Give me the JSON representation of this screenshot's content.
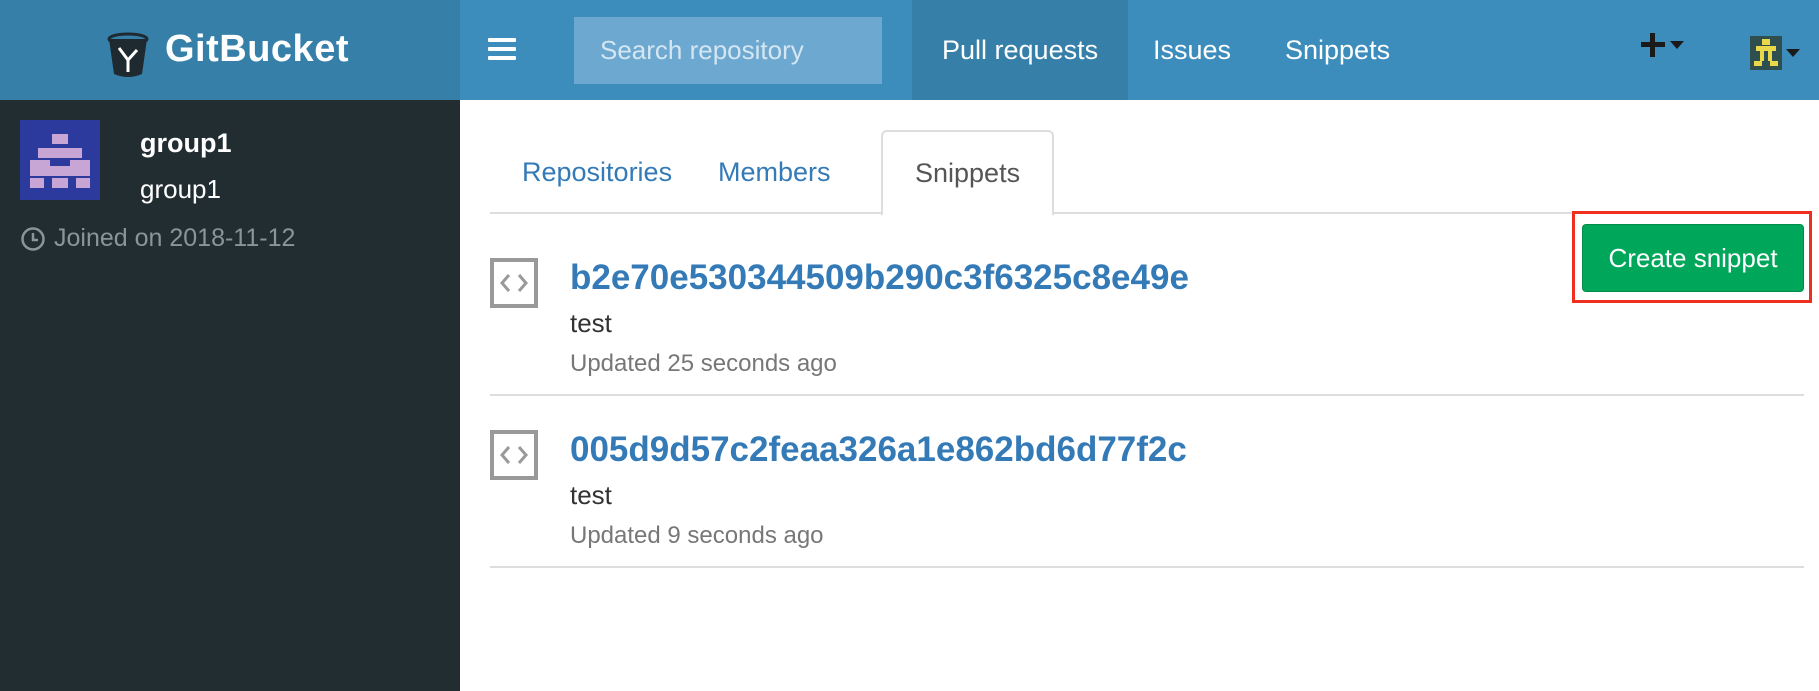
{
  "header": {
    "brand": "GitBucket",
    "search_placeholder": "Search repository",
    "nav": [
      "Pull requests",
      "Issues",
      "Snippets"
    ],
    "active_nav": "Pull requests",
    "plus_icon": "plus-icon",
    "user_icon": "user-avatar-icon"
  },
  "sidebar": {
    "group_name": "group1",
    "group_display": "group1",
    "joined": "Joined on 2018-11-12"
  },
  "tabs": [
    "Repositories",
    "Members",
    "Snippets"
  ],
  "active_tab": "Snippets",
  "create_button": "Create snippet",
  "snippets": [
    {
      "title": "b2e70e530344509b290c3f6325c8e49e",
      "description": "test",
      "updated": "Updated 25 seconds ago"
    },
    {
      "title": "005d9d57c2feaa326a1e862bd6d77f2c",
      "description": "test",
      "updated": "Updated 9 seconds ago"
    }
  ],
  "colors": {
    "header": "#3c8dbc",
    "brand_bg": "#367fa9",
    "sidebar": "#222d32",
    "link": "#337ab7",
    "success": "#00a65a",
    "highlight": "#ee2f1d"
  }
}
